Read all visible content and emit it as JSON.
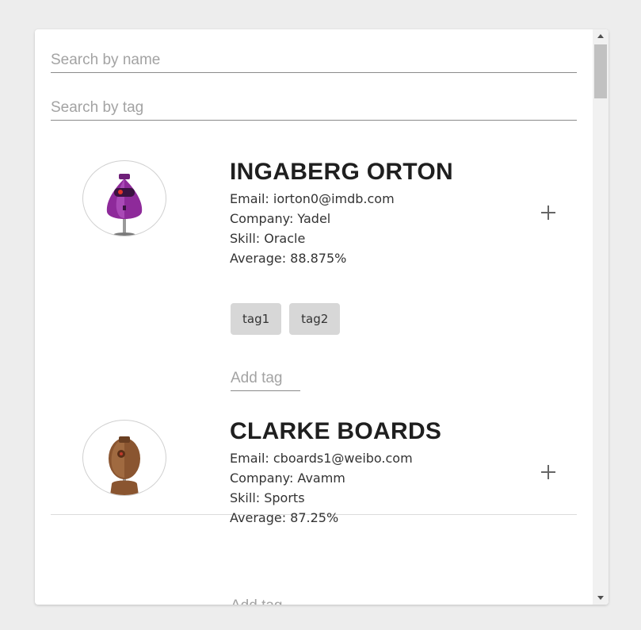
{
  "search": {
    "name_placeholder": "Search by name",
    "tag_placeholder": "Search by tag"
  },
  "students": [
    {
      "name": "INGABERG ORTON",
      "email": "Email: iorton0@imdb.com",
      "company": "Company: Yadel",
      "skill": "Skill: Oracle",
      "average": "Average: 88.875%",
      "avatar_icon": "robot-avatar-purple",
      "avatar_color": "#8e2a9a",
      "tags": [
        "tag1",
        "tag2"
      ],
      "add_tag_placeholder": "Add tag"
    },
    {
      "name": "CLARKE BOARDS",
      "email": "Email: cboards1@weibo.com",
      "company": "Company: Avamm",
      "skill": "Skill: Sports",
      "average": "Average: 87.25%",
      "avatar_icon": "robot-avatar-brown",
      "avatar_color": "#8a5530",
      "tags": [],
      "add_tag_placeholder": "Add tag"
    }
  ],
  "colors": {
    "background": "#ededed",
    "card": "#ffffff",
    "tag_chip": "#d7d7d7",
    "underline": "#8a8a8a"
  }
}
